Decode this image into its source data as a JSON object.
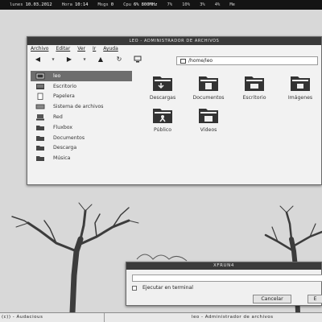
{
  "topbar": {
    "day": "lunes",
    "date": "10.03.2012",
    "time_label": "Hora",
    "time": "10:14",
    "msgs_label": "Msgs",
    "msgs": "0",
    "cpu_label": "Cpu",
    "cpu": "6%",
    "freq": "800MHz",
    "p1": "7%",
    "p2": "10%",
    "p3": "3%",
    "p4": "4%",
    "mem_label": "Me"
  },
  "file_manager": {
    "title": "leo - Administrador de archivos",
    "menu": [
      "Archivo",
      "Editar",
      "Ver",
      "Ir",
      "Ayuda"
    ],
    "toolbar_icons": [
      "back-arrow-icon",
      "dropdown-icon",
      "forward-arrow-icon",
      "dropdown-icon",
      "up-arrow-icon",
      "reload-icon",
      "computer-icon"
    ],
    "location": "/home/leo",
    "sidebar": [
      {
        "label": "leo",
        "icon": "home-folder-icon",
        "selected": true
      },
      {
        "label": "Escritorio",
        "icon": "desktop-icon"
      },
      {
        "label": "Papelera",
        "icon": "trash-icon"
      },
      {
        "label": "Sistema de archivos",
        "icon": "drive-icon"
      },
      {
        "label": "Red",
        "icon": "network-icon"
      },
      {
        "label": "Fluxbox",
        "icon": "folder-icon"
      },
      {
        "label": "Documentos",
        "icon": "folder-icon"
      },
      {
        "label": "Descarga",
        "icon": "folder-icon"
      },
      {
        "label": "Música",
        "icon": "folder-icon"
      }
    ],
    "folders": [
      {
        "label": "Descargas",
        "icon": "download-folder-icon"
      },
      {
        "label": "Documentos",
        "icon": "documents-folder-icon"
      },
      {
        "label": "Escritorio",
        "icon": "desktop-folder-icon"
      },
      {
        "label": "Imágenes",
        "icon": "pictures-folder-icon"
      },
      {
        "label": "Público",
        "icon": "public-folder-icon"
      },
      {
        "label": "Vídeos",
        "icon": "videos-folder-icon"
      }
    ]
  },
  "dialog": {
    "title": "xfrun4",
    "input_value": "",
    "checkbox_label": "Ejecutar en terminal",
    "checkbox_checked": false,
    "cancel_label": "Cancelar",
    "run_label": "E"
  },
  "taskbar": {
    "task1": "(c)) - Audacious",
    "task2": "leo - Administrador de archivos"
  },
  "colors": {
    "titlebar": "#3a3a3a",
    "selection": "#6d6d6d",
    "topbar": "#141414",
    "wallpaper": "#d8d8d8",
    "tree": "#3c3c3c"
  }
}
